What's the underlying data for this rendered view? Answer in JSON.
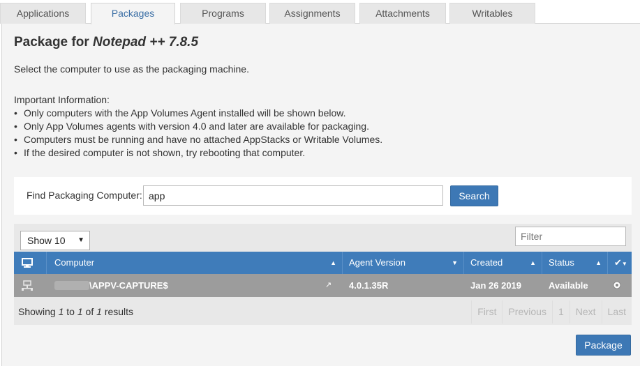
{
  "tabs": [
    {
      "label": "Applications",
      "active": false
    },
    {
      "label": "Packages",
      "active": true
    },
    {
      "label": "Programs",
      "active": false
    },
    {
      "label": "Assignments",
      "active": false
    },
    {
      "label": "Attachments",
      "active": false
    },
    {
      "label": "Writables",
      "active": false
    }
  ],
  "page": {
    "title_prefix": "Package for",
    "title_app": "Notepad ++ 7.8.5",
    "description": "Select the computer to use as the packaging machine.",
    "info_heading": "Important Information:",
    "info_items": [
      "Only computers with the App Volumes Agent installed will be shown below.",
      "Only App Volumes agents with version 4.0 and later are available for packaging.",
      "Computers must be running and have no attached AppStacks or Writable Volumes.",
      "If the desired computer is not shown, try rebooting that computer."
    ]
  },
  "find": {
    "label": "Find Packaging Computer:",
    "value": "app",
    "search_label": "Search"
  },
  "table": {
    "show_value": "Show 10",
    "filter_placeholder": "Filter",
    "columns": {
      "computer": "Computer",
      "agent_version": "Agent Version",
      "created": "Created",
      "status": "Status"
    },
    "rows": [
      {
        "computer": "\\APPV-CAPTURE$",
        "agent_version": "4.0.1.35R",
        "created": "Jan 26 2019",
        "status": "Available"
      }
    ],
    "footer": {
      "showing": "Showing",
      "from": "1",
      "to_word": "to",
      "to": "1",
      "of_word": "of",
      "total": "1",
      "results": "results"
    },
    "pager": {
      "first": "First",
      "previous": "Previous",
      "page": "1",
      "next": "Next",
      "last": "Last"
    }
  },
  "actions": {
    "package_label": "Package"
  },
  "colors": {
    "header_blue": "#3f7cba",
    "button_blue": "#3d78b5",
    "active_tab_text": "#3a6ea5",
    "row_gray": "#9c9c9c"
  }
}
